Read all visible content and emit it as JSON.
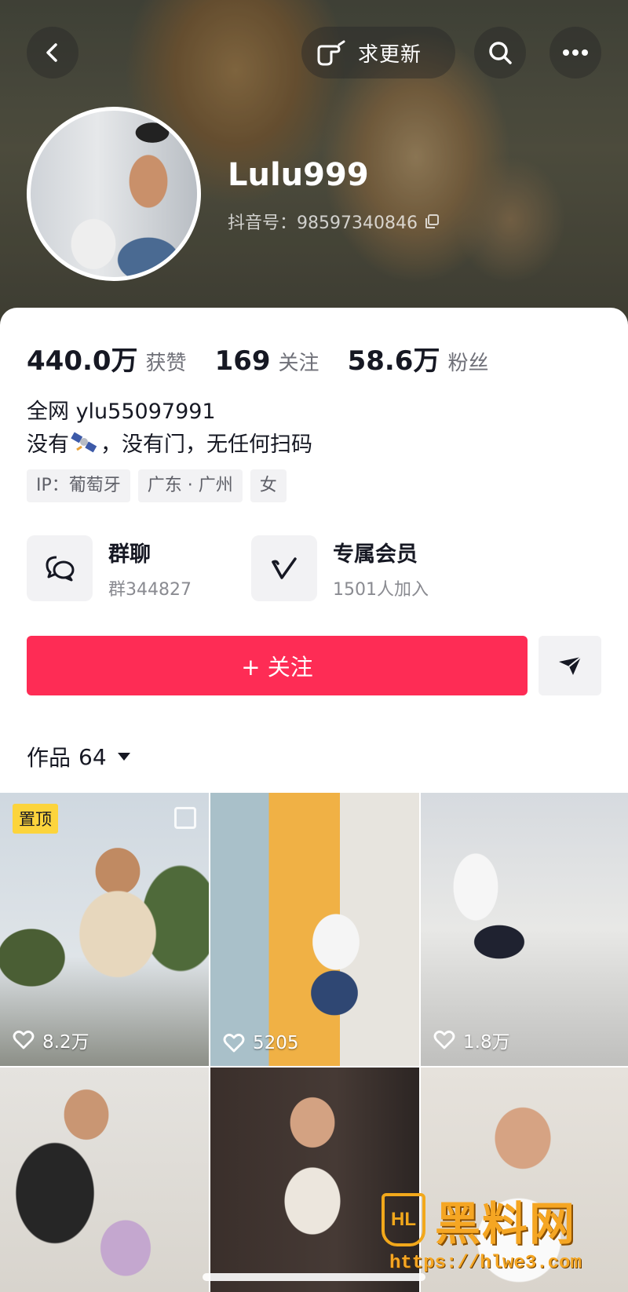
{
  "header": {
    "update_label": "求更新",
    "username": "Lulu999",
    "douyin_id": "抖音号：98597340846"
  },
  "stats": [
    {
      "value": "440.0万",
      "label": "获赞"
    },
    {
      "value": "169",
      "label": "关注"
    },
    {
      "value": "58.6万",
      "label": "粉丝"
    }
  ],
  "bio": {
    "line1": "全网 ylu55097991",
    "line2_before": "没有",
    "line2_after": "，没有门，无任何扫码"
  },
  "tags": [
    "IP：葡萄牙",
    "广东 · 广州",
    "女"
  ],
  "features": {
    "group": {
      "title": "群聊",
      "subtitle": "群344827"
    },
    "member": {
      "title": "专属会员",
      "subtitle": "1501人加入"
    }
  },
  "follow_label": "+ 关注",
  "works": {
    "label": "作品",
    "count": "64"
  },
  "videos": [
    {
      "likes": "8.2万",
      "pinned": "置顶"
    },
    {
      "likes": "5205"
    },
    {
      "likes": "1.8万"
    },
    {},
    {},
    {}
  ],
  "watermark": {
    "title": "黑料网",
    "logo_text": "HL",
    "url": "https://hlwe3.com"
  },
  "colors": {
    "accent": "#fe2c55",
    "pin": "#fcd43c",
    "watermark": "#f5a623"
  }
}
